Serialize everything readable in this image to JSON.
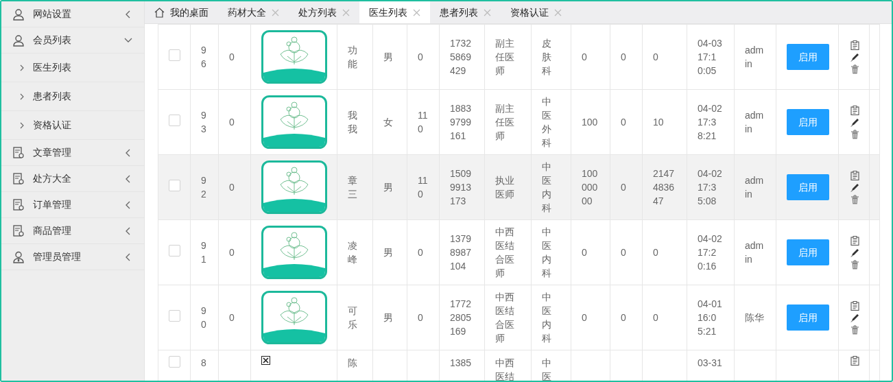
{
  "sidebar": {
    "items": [
      {
        "label": "网站设置",
        "kind": "user",
        "expanded": false
      },
      {
        "label": "会员列表",
        "kind": "user",
        "expanded": true,
        "children": [
          {
            "label": "医生列表"
          },
          {
            "label": "患者列表"
          },
          {
            "label": "资格认证"
          }
        ]
      },
      {
        "label": "文章管理",
        "kind": "doc",
        "expanded": false
      },
      {
        "label": "处方大全",
        "kind": "doc",
        "expanded": false
      },
      {
        "label": "订单管理",
        "kind": "doc",
        "expanded": false
      },
      {
        "label": "商品管理",
        "kind": "doc",
        "expanded": false
      },
      {
        "label": "管理员管理",
        "kind": "admin",
        "expanded": false
      }
    ]
  },
  "tabs": [
    {
      "label": "我的桌面",
      "kind": "home",
      "selected": false
    },
    {
      "label": "药材大全",
      "kind": "closable",
      "selected": false
    },
    {
      "label": "处方列表",
      "kind": "closable",
      "selected": false
    },
    {
      "label": "医生列表",
      "kind": "closable",
      "selected": true
    },
    {
      "label": "患者列表",
      "kind": "closable",
      "selected": false
    },
    {
      "label": "资格认证",
      "kind": "closable",
      "selected": false
    }
  ],
  "table": {
    "rows": [
      {
        "checked": false,
        "highlighted": false,
        "kind": "full",
        "cells": [
          "96",
          "0",
          "功能",
          "男",
          "0",
          "17325869429",
          "副主任医师",
          "皮肤科",
          "0",
          "0",
          "0",
          "04-03 17:10:05",
          "admin"
        ],
        "button": "启用"
      },
      {
        "checked": false,
        "highlighted": false,
        "kind": "full",
        "cells": [
          "93",
          "0",
          "我我",
          "女",
          "110",
          "18839799161",
          "副主任医师",
          "中医外科",
          "100",
          "0",
          "10",
          "04-02 17:38:21",
          "admin"
        ],
        "button": "启用"
      },
      {
        "checked": false,
        "highlighted": true,
        "kind": "full",
        "cells": [
          "92",
          "0",
          "章三",
          "男",
          "110",
          "15099913173",
          "执业医师",
          "中医内科",
          "10000000",
          "0",
          "2147483647",
          "04-02 17:35:08",
          "admin"
        ],
        "button": "启用"
      },
      {
        "checked": false,
        "highlighted": false,
        "kind": "full",
        "cells": [
          "91",
          "0",
          "凌峰",
          "男",
          "0",
          "13798987104",
          "中西医结合医师",
          "中医内科",
          "0",
          "0",
          "0",
          "04-02 17:20:16",
          "admin"
        ],
        "button": "启用"
      },
      {
        "checked": false,
        "highlighted": false,
        "kind": "full",
        "cells": [
          "90",
          "0",
          "可乐",
          "男",
          "0",
          "17722805169",
          "中西医结合医师",
          "中医内科",
          "0",
          "0",
          "0",
          "04-01 16:05:21",
          "陈华"
        ],
        "button": "启用"
      },
      {
        "checked": false,
        "highlighted": false,
        "kind": "cut",
        "cells": [
          "8",
          "",
          "陈",
          "",
          "",
          "1385",
          "中西医结",
          "中医",
          "",
          "",
          "",
          "03-31",
          ""
        ]
      }
    ]
  }
}
